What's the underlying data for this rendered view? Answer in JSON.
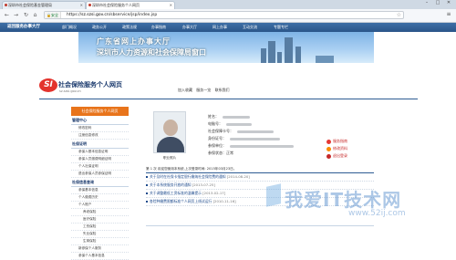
{
  "browser": {
    "tabs": [
      {
        "label": "深圳市社会保险基金管理局",
        "active": false
      },
      {
        "label": "深圳市社会保险服务个人网页",
        "active": true
      }
    ],
    "url_secure_label": "安全",
    "url_prefix": "https://",
    "url_domain": "sz.szsi.gov.cn",
    "url_path": "/sbservice/jsp/index.jsp"
  },
  "site_nav": {
    "brand": "返回服务办事大厅",
    "items": [
      "部门概况",
      "政务公开",
      "政策法规",
      "办事指南",
      "办事大厅",
      "网上办事",
      "互动交流",
      "专题专栏"
    ]
  },
  "banner": {
    "line1": "广东省网上办事大厅",
    "line2": "深圳市人力资源和社会保障局窗口"
  },
  "header": {
    "logo_text": "SI",
    "title": "社会保险服务个人网页",
    "subtitle": "sz.szsi.gov.cn",
    "links": [
      "加入收藏",
      "服务一览",
      "联系我们"
    ]
  },
  "sidebar": {
    "header": "社会保险服务个人网页",
    "sections": [
      {
        "title": "管理中心",
        "items": [
          "修改密码",
          "注册信息修改"
        ]
      },
      {
        "title": "社保证明",
        "items": [
          "参保人基本信息证明",
          "参保人员缴费明细证明",
          "个人社保证明",
          "退出参保人员参保证明"
        ]
      },
      {
        "title": "社保信息查询",
        "items": [
          "参保基本信息",
          "个人缴费历史",
          "个人账户",
          "养老保险",
          "医疗保险",
          "工伤保险",
          "失业保险",
          "生育保险",
          "新参保个人服务",
          "参保个人基本信息"
        ]
      }
    ]
  },
  "profile": {
    "photo_caption": "职业照片",
    "fields": [
      {
        "label": "姓名：",
        "blur": 30
      },
      {
        "label": "电脑号：",
        "blur": 28
      },
      {
        "label": "社会保障卡号：",
        "blur": 40
      },
      {
        "label": "身份证号：",
        "blur": 55
      },
      {
        "label": "参保单位：",
        "blur": 70
      },
      {
        "label": "参保状态：",
        "value": "正常"
      }
    ]
  },
  "actions": [
    {
      "label": "服务指南",
      "color": "#e53935"
    },
    {
      "label": "修改资料",
      "color": "#fb8c00"
    },
    {
      "label": "退出登录",
      "color": "#c62828"
    }
  ],
  "welcome": "第 1 次  欢迎您使用本系统,上次登录时间: 2015年03月23日。",
  "news": [
    {
      "title": "关于及时在社保卡指定银行缴纳社会保险费的通知",
      "date": "[2014-08-20]"
    },
    {
      "title": "关于本系统服务开放的通知",
      "date": "[2013-07-25]"
    },
    {
      "title": "关于调整最低工资标准的温馨提示",
      "date": "[2013-02-17]"
    },
    {
      "title": "各险种缴费限额标准个人网页上线试运行",
      "date": "[2010-11-16]"
    }
  ],
  "watermark": {
    "big": "我爱IT技术网",
    "small": "www.52ij.com"
  }
}
